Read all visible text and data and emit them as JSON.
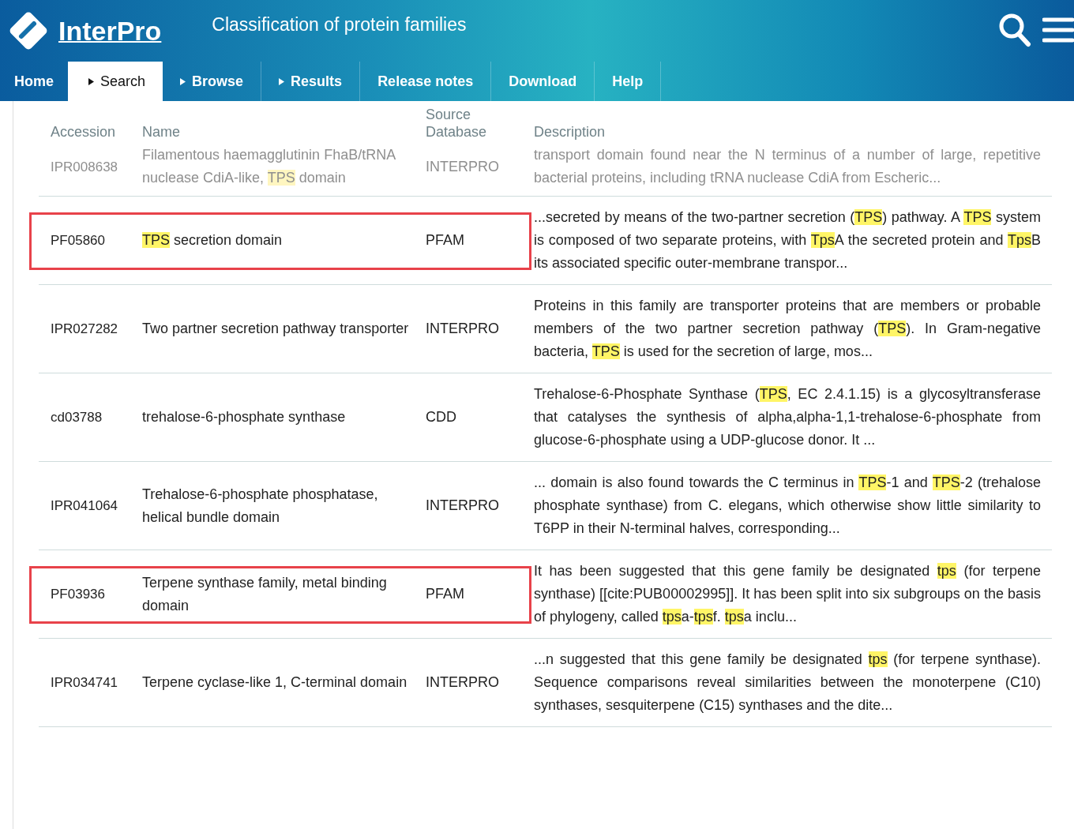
{
  "header": {
    "brand": "InterPro",
    "tagline": "Classification of protein families"
  },
  "nav": [
    {
      "label": "Home",
      "selected": false,
      "has_arrow": false
    },
    {
      "label": "Search",
      "selected": true,
      "has_arrow": true
    },
    {
      "label": "Browse",
      "selected": false,
      "has_arrow": true
    },
    {
      "label": "Results",
      "selected": false,
      "has_arrow": true
    },
    {
      "label": "Release notes",
      "selected": false,
      "has_arrow": false
    },
    {
      "label": "Download",
      "selected": false,
      "has_arrow": false
    },
    {
      "label": "Help",
      "selected": false,
      "has_arrow": false
    }
  ],
  "table": {
    "columns": [
      "Accession",
      "Name",
      "Source Database",
      "Description"
    ],
    "rows": [
      {
        "accession": "IPR008638",
        "name": "Filamentous haemagglutinin FhaB/tRNA nuclease CdiA-like, **TPS** domain",
        "source": "INTERPRO",
        "description": "transport domain found near the N terminus of a number of large, repetitive bacterial proteins, including tRNA nuclease CdiA from Escheric...",
        "faded": true,
        "outlined": false
      },
      {
        "accession": "PF05860",
        "name": "**TPS** secretion domain",
        "source": "PFAM",
        "description": "...secreted by means of the two-partner secretion (**TPS**) pathway. A **TPS** system is composed of two separate proteins, with **Tps**A the secreted protein and **Tps**B its associated specific outer-membrane transpor...",
        "faded": false,
        "outlined": true
      },
      {
        "accession": "IPR027282",
        "name": "Two partner secretion pathway transporter",
        "source": "INTERPRO",
        "description": "Proteins in this family are transporter proteins that are members or probable members of the two partner secretion pathway (**TPS**). In Gram-negative bacteria, **TPS** is used for the secretion of large, mos...",
        "faded": false,
        "outlined": false
      },
      {
        "accession": "cd03788",
        "name": "trehalose-6-phosphate synthase",
        "source": "CDD",
        "description": "Trehalose-6-Phosphate Synthase (**TPS**, EC 2.4.1.15) is a glycosyltransferase that catalyses the synthesis of alpha,alpha-1,1-trehalose-6-phosphate from glucose-6-phosphate using a UDP-glucose donor. It ...",
        "faded": false,
        "outlined": false
      },
      {
        "accession": "IPR041064",
        "name": "Trehalose-6-phosphate phosphatase, helical bundle domain",
        "source": "INTERPRO",
        "description": "... domain is also found towards the C terminus in **TPS**-1 and **TPS**-2 (trehalose phosphate synthase) from C. elegans, which otherwise show little similarity to T6PP in their N-terminal halves, corresponding...",
        "faded": false,
        "outlined": false
      },
      {
        "accession": "PF03936",
        "name": "Terpene synthase family, metal binding domain",
        "source": "PFAM",
        "description": "It has been suggested that this gene family be designated **tps** (for terpene synthase) [[cite:PUB00002995]]. It has been split into six subgroups on the basis of phylogeny, called **tps**a-**tps**f. **tps**a inclu...",
        "faded": false,
        "outlined": true
      },
      {
        "accession": "IPR034741",
        "name": "Terpene cyclase-like 1, C-terminal domain",
        "source": "INTERPRO",
        "description": "...n suggested that this gene family be designated **tps** (for terpene synthase). Sequence comparisons reveal similarities between the monoterpene (C10) synthases, sesquiterpene (C15) synthases and the dite...",
        "faded": false,
        "outlined": false
      }
    ]
  }
}
